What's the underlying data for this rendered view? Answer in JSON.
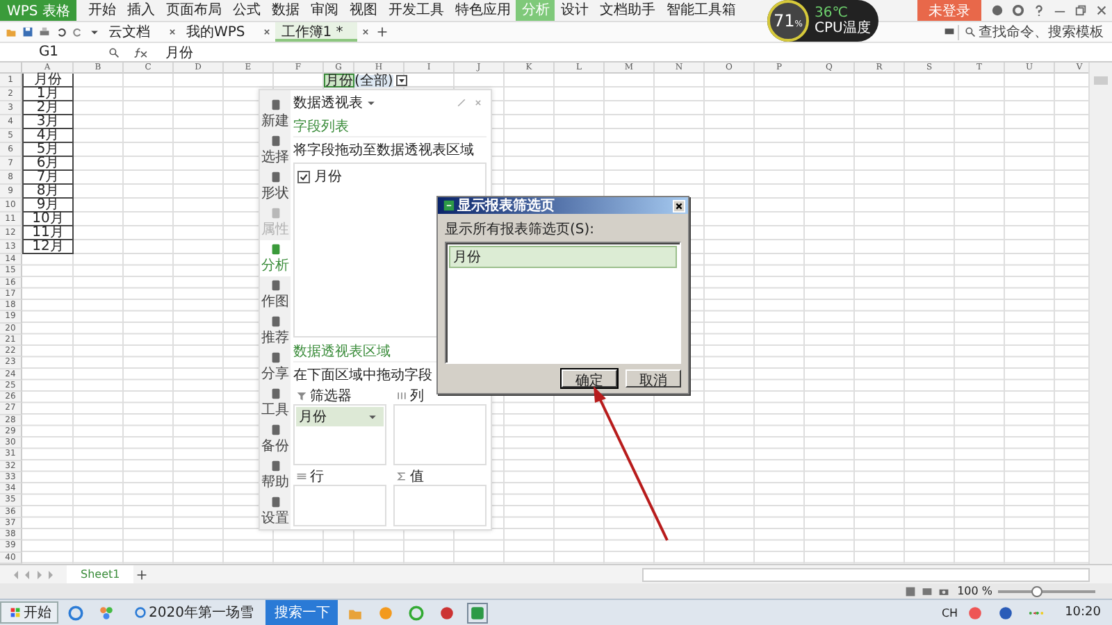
{
  "app": {
    "logo": "WPS 表格"
  },
  "ribbon_tabs": [
    {
      "label": "开始",
      "selected": false
    },
    {
      "label": "插入",
      "selected": false
    },
    {
      "label": "页面布局",
      "selected": false
    },
    {
      "label": "公式",
      "selected": false
    },
    {
      "label": "数据",
      "selected": false
    },
    {
      "label": "审阅",
      "selected": false
    },
    {
      "label": "视图",
      "selected": false
    },
    {
      "label": "开发工具",
      "selected": false
    },
    {
      "label": "特色应用",
      "selected": false
    },
    {
      "label": "分析",
      "selected": true
    },
    {
      "label": "设计",
      "selected": false
    },
    {
      "label": "文档助手",
      "selected": false
    },
    {
      "label": "智能工具箱",
      "selected": false
    }
  ],
  "cpu_monitor": {
    "usage": "71",
    "unit": "%",
    "temperature": "36℃",
    "label": "CPU温度"
  },
  "login_button": "未登录",
  "doc_tabs": [
    {
      "label": "云文档",
      "selected": false
    },
    {
      "label": "我的WPS",
      "selected": false
    },
    {
      "label": "工作簿1 *",
      "selected": true
    }
  ],
  "search": {
    "placeholder": "查找命令、搜索模板"
  },
  "formula_bar": {
    "cell": "G1",
    "value": "月份"
  },
  "sheet": {
    "columns": [
      "A",
      "B",
      "C",
      "D",
      "E",
      "F",
      "G",
      "H",
      "I",
      "J",
      "K",
      "L",
      "M",
      "N",
      "O",
      "P",
      "Q",
      "R",
      "S",
      "T",
      "U",
      "V"
    ],
    "row_numbers": [
      "1",
      "2",
      "3",
      "4",
      "5",
      "6",
      "7",
      "8",
      "9",
      "10",
      "11",
      "12",
      "13",
      "14",
      "15",
      "16",
      "17",
      "18",
      "19",
      "20",
      "21",
      "22",
      "23",
      "24",
      "25",
      "26",
      "27",
      "28",
      "29",
      "30",
      "31",
      "32",
      "33",
      "34",
      "35",
      "36",
      "37",
      "38",
      "39",
      "40"
    ],
    "column_a": [
      "月份",
      "1月",
      "2月",
      "3月",
      "4月",
      "5月",
      "6月",
      "7月",
      "8月",
      "9月",
      "10月",
      "11月",
      "12月"
    ],
    "pivot_filter": {
      "field": "月份",
      "value": "(全部)",
      "selected": true
    }
  },
  "pivot_panel": {
    "title": "数据透视表",
    "tools": [
      {
        "label": "新建",
        "selected": false,
        "disabled": false
      },
      {
        "label": "选择",
        "selected": false,
        "disabled": false
      },
      {
        "label": "形状",
        "selected": false,
        "disabled": false
      },
      {
        "label": "属性",
        "selected": false,
        "disabled": true
      },
      {
        "label": "分析",
        "selected": true,
        "disabled": false
      },
      {
        "label": "作图",
        "selected": false,
        "disabled": false
      },
      {
        "label": "推荐",
        "selected": false,
        "disabled": false
      },
      {
        "label": "分享",
        "selected": false,
        "disabled": false
      },
      {
        "label": "工具",
        "selected": false,
        "disabled": false
      },
      {
        "label": "备份",
        "selected": false,
        "disabled": false
      },
      {
        "label": "帮助",
        "selected": false,
        "disabled": false
      },
      {
        "label": "设置",
        "selected": false,
        "disabled": false
      }
    ],
    "field_section": "字段列表",
    "field_hint": "将字段拖动至数据透视表区域",
    "fields": [
      {
        "label": "月份",
        "checked": true
      }
    ],
    "area_section": "数据透视表区域",
    "area_hint": "在下面区域中拖动字段",
    "areas": [
      {
        "label": "筛选器",
        "kind": "filter",
        "items": [
          "月份"
        ]
      },
      {
        "label": "列",
        "kind": "column"
      },
      {
        "label": "行",
        "kind": "row"
      },
      {
        "label": "值",
        "kind": "value"
      }
    ]
  },
  "dialog": {
    "title": "显示报表筛选页",
    "label": "显示所有报表筛选页(S):",
    "items": [
      {
        "label": "月份",
        "selected": true
      }
    ],
    "buttons": [
      "确定",
      "取消"
    ]
  },
  "sheet_tabs": [
    {
      "label": "Sheet1",
      "selected": true
    }
  ],
  "status_bar": {
    "zoom": {
      "reading": "100 %",
      "level": 0.4
    }
  },
  "taskbar": {
    "start": "开始",
    "windows": [
      {
        "label": "2020年第一场雪"
      }
    ],
    "search_button": "搜索一下",
    "language": "CH",
    "clock": "10:20"
  }
}
